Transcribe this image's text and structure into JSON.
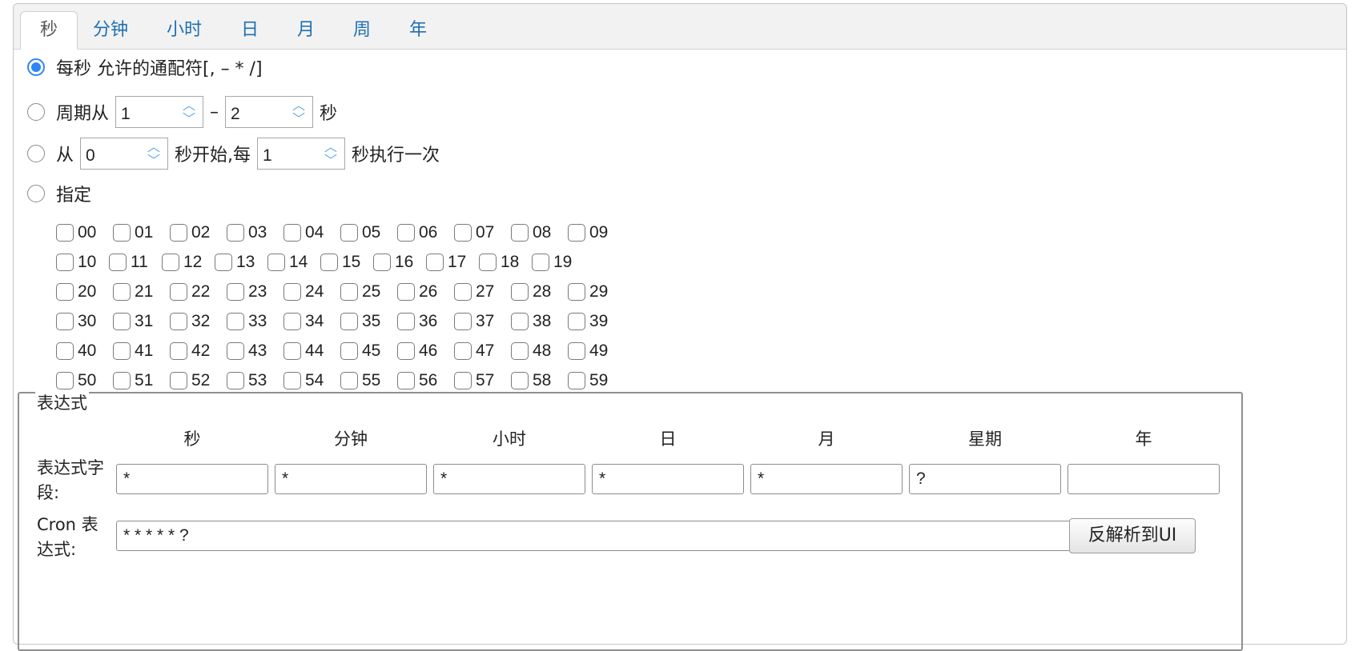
{
  "tabs": [
    "秒",
    "分钟",
    "小时",
    "日",
    "月",
    "周",
    "年"
  ],
  "options": {
    "every": "每秒 允许的通配符[, – * /]",
    "cycle": {
      "prefix": "周期从",
      "from": "1",
      "dash": "–",
      "to": "2",
      "suffix": "秒"
    },
    "start": {
      "prefix": "从",
      "start": "0",
      "mid": "秒开始,每",
      "every": "1",
      "suffix": "秒执行一次"
    },
    "specify": "指定"
  },
  "seconds": [
    [
      "00",
      "01",
      "02",
      "03",
      "04",
      "05",
      "06",
      "07",
      "08",
      "09"
    ],
    [
      "10",
      "11",
      "12",
      "13",
      "14",
      "15",
      "16",
      "17",
      "18",
      "19"
    ],
    [
      "20",
      "21",
      "22",
      "23",
      "24",
      "25",
      "26",
      "27",
      "28",
      "29"
    ],
    [
      "30",
      "31",
      "32",
      "33",
      "34",
      "35",
      "36",
      "37",
      "38",
      "39"
    ],
    [
      "40",
      "41",
      "42",
      "43",
      "44",
      "45",
      "46",
      "47",
      "48",
      "49"
    ],
    [
      "50",
      "51",
      "52",
      "53",
      "54",
      "55",
      "56",
      "57",
      "58",
      "59"
    ]
  ],
  "expression": {
    "legend": "表达式",
    "columns": [
      "秒",
      "分钟",
      "小时",
      "日",
      "月",
      "星期",
      "年"
    ],
    "field_label": "表达式字段:",
    "fields": [
      "*",
      "*",
      "*",
      "*",
      "*",
      "?",
      ""
    ],
    "cron_label": "Cron 表达式:",
    "cron_value": "* * * * * ?",
    "parse_button": "反解析到UI"
  },
  "colors": {
    "accent": "#2e86f2",
    "tab_link": "#1f6fb2",
    "spinner_arrow": "#5aa7e6"
  }
}
